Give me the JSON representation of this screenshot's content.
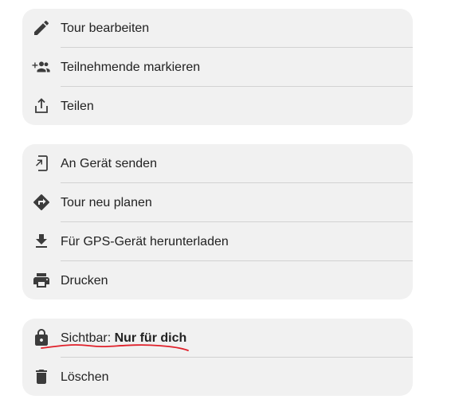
{
  "groups": [
    {
      "items": [
        {
          "label": "Tour bearbeiten",
          "icon": "pencil-icon"
        },
        {
          "label": "Teilnehmende markieren",
          "icon": "add-people-icon"
        },
        {
          "label": "Teilen",
          "icon": "share-icon"
        }
      ]
    },
    {
      "items": [
        {
          "label": "An Gerät senden",
          "icon": "send-to-device-icon"
        },
        {
          "label": "Tour neu planen",
          "icon": "route-icon"
        },
        {
          "label": "Für GPS-Gerät herunterladen",
          "icon": "download-icon"
        },
        {
          "label": "Drucken",
          "icon": "printer-icon"
        }
      ]
    },
    {
      "items": [
        {
          "label_prefix": "Sichtbar: ",
          "label_value": "Nur für dich",
          "icon": "lock-icon"
        },
        {
          "label": "Löschen",
          "icon": "trash-icon"
        }
      ]
    }
  ],
  "colors": {
    "card_background": "#f1f1f1",
    "divider": "#d2d2d2",
    "icon": "#3c3c3c",
    "text": "#222222",
    "annotation_underline": "#e0202a"
  }
}
